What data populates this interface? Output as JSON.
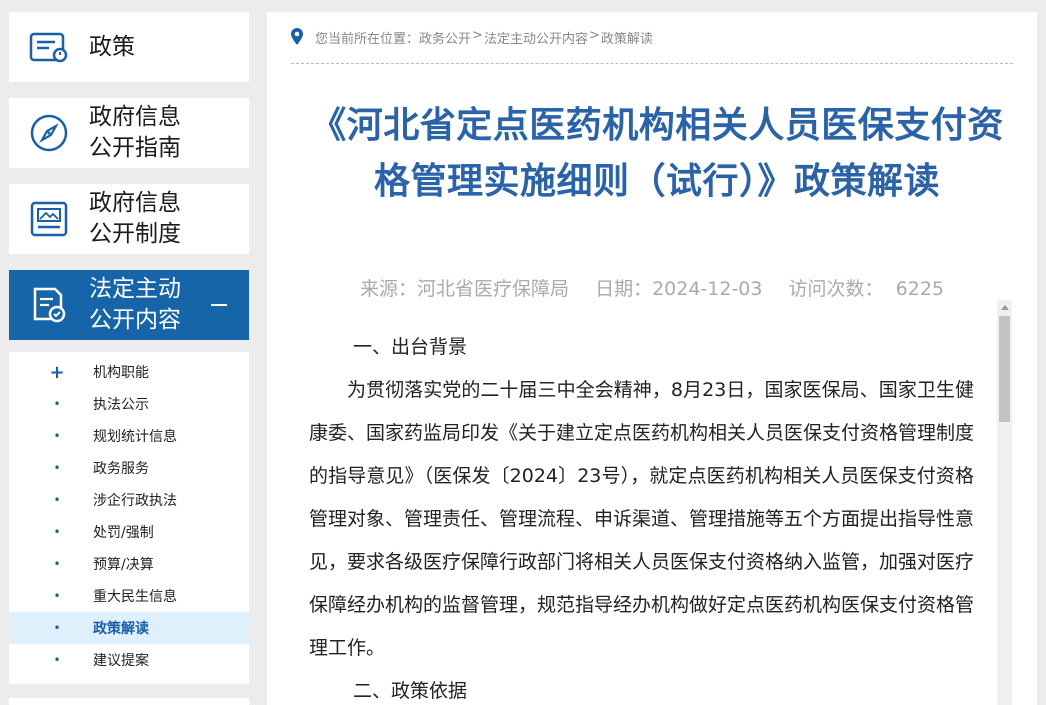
{
  "sidebar": {
    "policy": {
      "label": "政策",
      "icon": "policy-doc-icon"
    },
    "guide": {
      "label_line1": "政府信息",
      "label_line2": "公开指南",
      "icon": "compass-icon"
    },
    "system": {
      "label_line1": "政府信息",
      "label_line2": "公开制度",
      "icon": "monitor-doc-icon"
    },
    "active_section": {
      "label_line1": "法定主动",
      "label_line2": "公开内容",
      "icon": "document-icon",
      "toggle": "collapse"
    },
    "submenu": [
      {
        "label": "机构职能",
        "marker": "+"
      },
      {
        "label": "执法公示",
        "marker": "•"
      },
      {
        "label": "规划统计信息",
        "marker": "•"
      },
      {
        "label": "政务服务",
        "marker": "•"
      },
      {
        "label": "涉企行政执法",
        "marker": "•"
      },
      {
        "label": "处罚/强制",
        "marker": "•"
      },
      {
        "label": "预算/决算",
        "marker": "•"
      },
      {
        "label": "重大民生信息",
        "marker": "•"
      },
      {
        "label": "政策解读",
        "marker": "•",
        "selected": true
      },
      {
        "label": "建议提案",
        "marker": "•"
      }
    ]
  },
  "breadcrumb": {
    "prefix": "您当前所在位置：",
    "items": [
      "政务公开",
      "法定主动公开内容",
      "政策解读"
    ],
    "separator": ">"
  },
  "article": {
    "title": "《河北省定点医药机构相关人员医保支付资格管理实施细则（试行）》政策解读",
    "source": "来源：河北省医疗保障局",
    "date": "日期：2024-12-03",
    "visits_label": "访问次数：",
    "visits": "6225",
    "heading1": "一、出台背景",
    "paragraph1": "为贯彻落实党的二十届三中全会精神，8月23日，国家医保局、国家卫生健康委、国家药监局印发《关于建立定点医药机构相关人员医保支付资格管理制度的指导意见》（医保发〔2024〕23号），就定点医药机构相关人员医保支付资格管理对象、管理责任、管理流程、申诉渠道、管理措施等五个方面提出指导性意见，要求各级医疗保障行政部门将相关人员医保支付资格纳入监管，加强对医疗保障经办机构的监督管理，规范指导经办机构做好定点医药机构医保支付资格管理工作。",
    "heading2": "二、政策依据"
  },
  "colors": {
    "accent": "#1565a8",
    "title": "#2a63a8",
    "selected_bg": "#ddf0fb"
  }
}
